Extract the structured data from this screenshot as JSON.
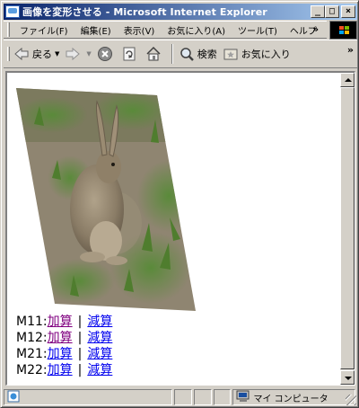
{
  "window": {
    "title": "画像を変形させる - Microsoft Internet Explorer",
    "minimize": "_",
    "maximize": "□",
    "close": "×"
  },
  "menu": {
    "items": [
      "ファイル(F)",
      "編集(E)",
      "表示(V)",
      "お気に入り(A)",
      "ツール(T)",
      "ヘルプ"
    ],
    "more": "»"
  },
  "toolbar": {
    "back": "戻る",
    "search": "検索",
    "favorites": "お気に入り",
    "more": "»"
  },
  "page": {
    "rows": [
      {
        "label": "M11:",
        "add": "加算",
        "sep": "|",
        "sub": "減算"
      },
      {
        "label": "M12:",
        "add": "加算",
        "sep": "|",
        "sub": "減算"
      },
      {
        "label": "M21:",
        "add": "加算",
        "sep": "|",
        "sub": "減算"
      },
      {
        "label": "M22:",
        "add": "加算",
        "sep": "|",
        "sub": "減算"
      }
    ]
  },
  "status": {
    "zone": "マイ コンピュータ"
  },
  "colors": {
    "titlebar_start": "#0a246a",
    "titlebar_end": "#a6caf0",
    "visited_link": "#800080",
    "link": "#0000ee"
  }
}
